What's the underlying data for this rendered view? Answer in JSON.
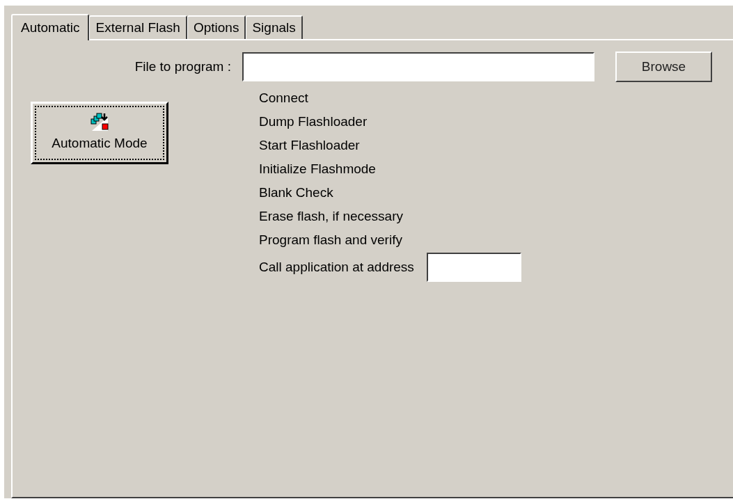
{
  "tabs": [
    {
      "label": "Automatic",
      "selected": true
    },
    {
      "label": "External Flash",
      "selected": false
    },
    {
      "label": "Options",
      "selected": false
    },
    {
      "label": "Signals",
      "selected": false
    }
  ],
  "file_field": {
    "label": "File to program :"
  },
  "browse_button": "Browse",
  "automatic_mode_button": {
    "label": "Automatic Mode",
    "focused": true
  },
  "steps": [
    "Connect",
    "Dump Flashloader",
    "Start Flashloader",
    "Initialize Flashmode",
    "Blank Check",
    "Erase flash, if necessary",
    "Program flash and verify"
  ],
  "address_field": {
    "label": "Call application at address"
  }
}
